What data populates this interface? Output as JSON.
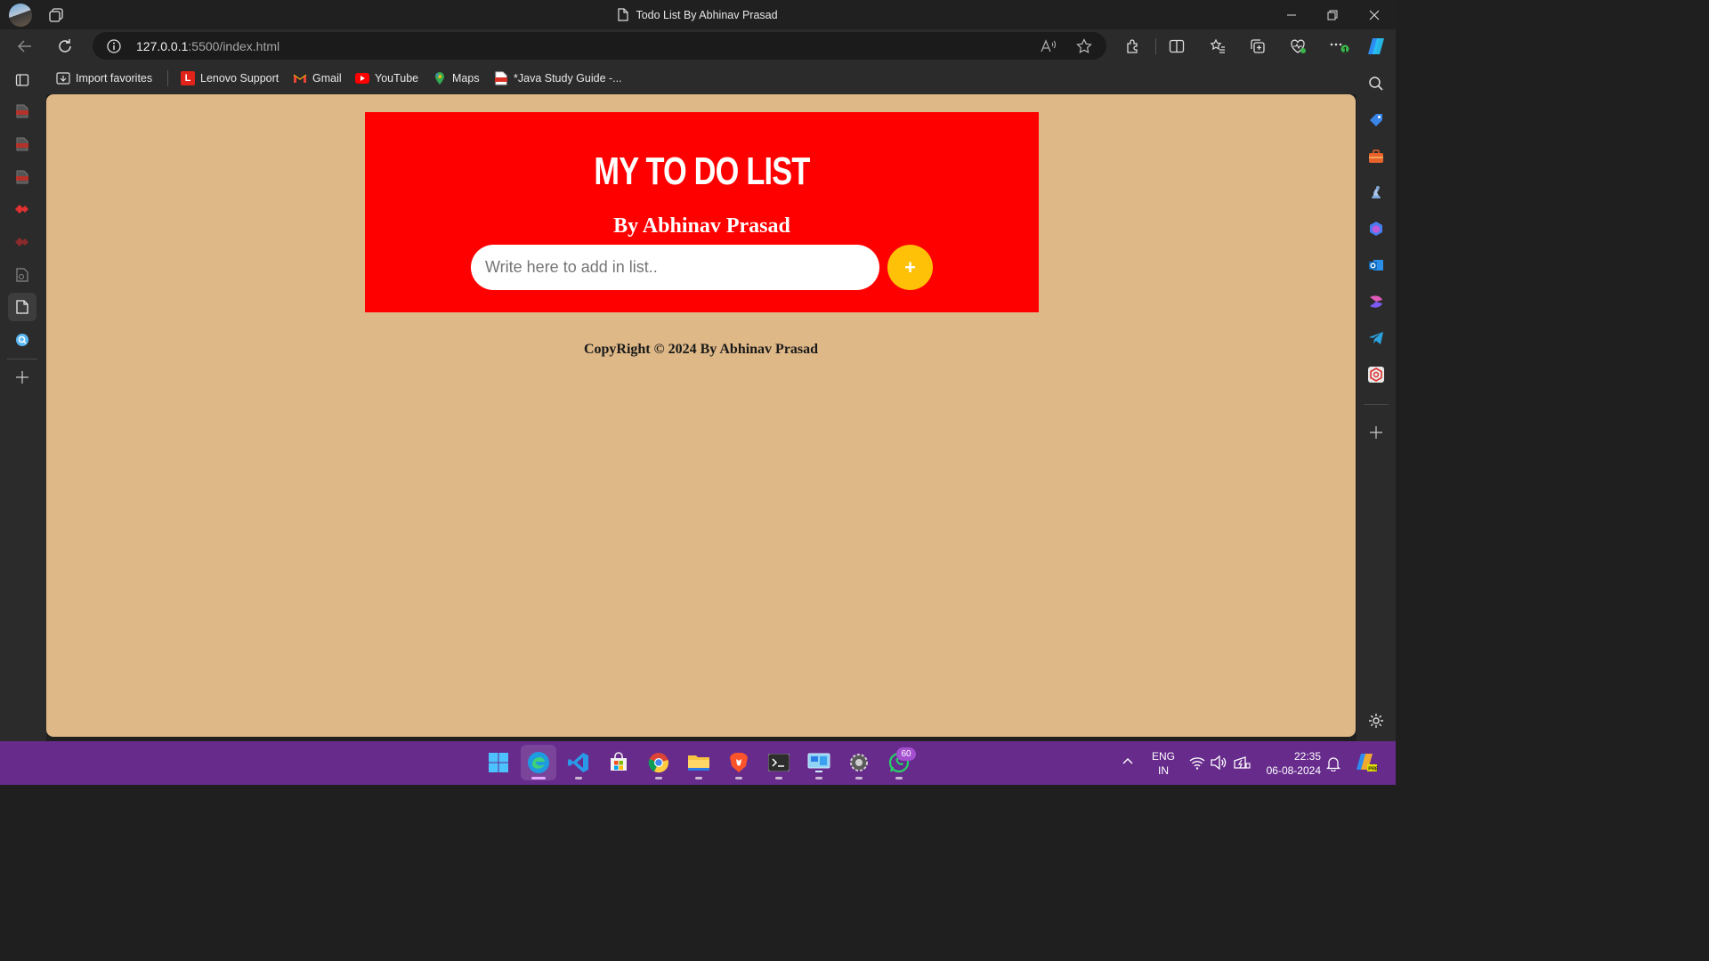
{
  "window": {
    "title": "Todo List By Abhinav Prasad"
  },
  "toolbar": {
    "url_host": "127.0.0.1",
    "url_rest": ":5500/index.html",
    "extensions_badge": "1"
  },
  "bookmarks": [
    {
      "label": "Import favorites",
      "icon": "import-icon"
    },
    {
      "label": "Lenovo Support",
      "icon": "lenovo-icon"
    },
    {
      "label": "Gmail",
      "icon": "gmail-icon"
    },
    {
      "label": "YouTube",
      "icon": "youtube-icon"
    },
    {
      "label": "Maps",
      "icon": "maps-icon"
    },
    {
      "label": "*Java Study Guide -...",
      "icon": "pdf-icon"
    }
  ],
  "page": {
    "heading": "MY TO DO LIST",
    "author": "By Abhinav Prasad",
    "input_placeholder": "Write here to add in list..",
    "add_button_label": "+",
    "footer": "CopyRight © 2024 By Abhinav Prasad",
    "colors": {
      "background": "#deb887",
      "card": "#ff0000",
      "button": "#ffc107"
    }
  },
  "taskbar": {
    "whatsapp_badge": "60",
    "language_line1": "ENG",
    "language_line2": "IN",
    "time": "22:35",
    "date": "06-08-2024",
    "accent": "#672b8c"
  }
}
